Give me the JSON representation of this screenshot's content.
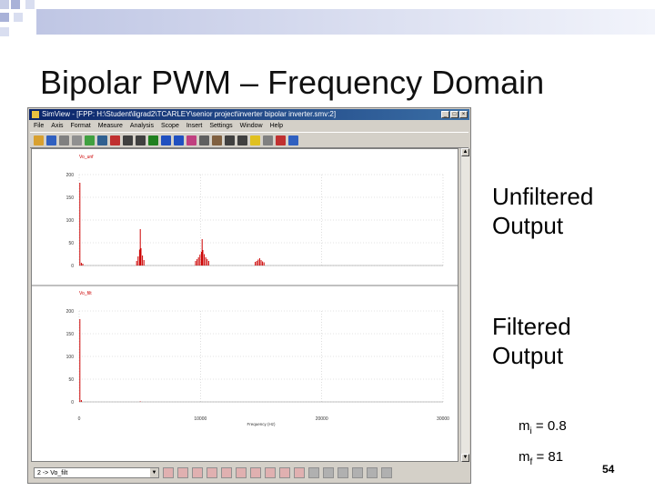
{
  "slide": {
    "title": "Bipolar PWM – Frequency Domain",
    "label_unfiltered": "Unfiltered Output",
    "label_filtered": "Filtered Output",
    "mi": {
      "symbol": "m",
      "sub": "i",
      "value": "= 0.8"
    },
    "mf": {
      "symbol": "m",
      "sub": "f",
      "value": "= 81"
    },
    "page_number": "54"
  },
  "window": {
    "title": "SimView - [FPP: H:\\Student\\ligrad2\\TCARLEY\\senior project\\inverter bipolar inverter.smv:2]",
    "menu": [
      "File",
      "Axis",
      "Format",
      "Measure",
      "Analysis",
      "Scope",
      "Insert",
      "Settings",
      "Window",
      "Help"
    ],
    "toolbar_icons": [
      "open-icon",
      "save-icon",
      "print-icon",
      "copy-icon",
      "zoom-icon",
      "chart-icon",
      "fft-icon",
      "x-icon",
      "y-icon",
      "cursor-icon",
      "zoom-in-icon",
      "zoom-out-icon",
      "measure-icon",
      "fit-icon",
      "text-icon",
      "line-icon",
      "arrow-icon",
      "clock-icon",
      "settings-icon",
      "marker-icon",
      "export-icon"
    ],
    "bottom_select_value": "2 -> Vo_filt"
  },
  "chart_data": [
    {
      "type": "bar",
      "title": "Vo_unf",
      "xlabel": "",
      "ylabel": "",
      "xlim": [
        0,
        30000
      ],
      "ylim": [
        0,
        200
      ],
      "yticks": [
        "200",
        "150",
        "100",
        "50",
        "0"
      ],
      "xticks": [],
      "x": [
        60,
        180,
        300,
        4740,
        4860,
        4980,
        5040,
        5100,
        5220,
        5340,
        9600,
        9720,
        9840,
        9960,
        10080,
        10140,
        10200,
        10320,
        10440,
        10560,
        10680,
        14520,
        14640,
        14760,
        14880,
        15000,
        15120,
        15240
      ],
      "values": [
        182,
        6,
        4,
        10,
        20,
        35,
        80,
        38,
        22,
        12,
        10,
        14,
        18,
        24,
        30,
        58,
        34,
        25,
        18,
        14,
        10,
        8,
        10,
        13,
        16,
        12,
        9,
        7
      ]
    },
    {
      "type": "bar",
      "title": "Vo_filt",
      "xlabel": "Frequency (Hz)",
      "ylabel": "",
      "xlim": [
        0,
        30000
      ],
      "ylim": [
        0,
        200
      ],
      "yticks": [
        "200",
        "150",
        "100",
        "50",
        "0"
      ],
      "xticks": [
        "0",
        "10000",
        "20000",
        "30000"
      ],
      "x": [
        60,
        180,
        5040
      ],
      "values": [
        182,
        4,
        1
      ]
    }
  ],
  "colors": {
    "spectrum": "#cc0000",
    "grid": "#c8c8c8",
    "deco_squares": "#d9def0",
    "titlebar": "#0a246a"
  }
}
